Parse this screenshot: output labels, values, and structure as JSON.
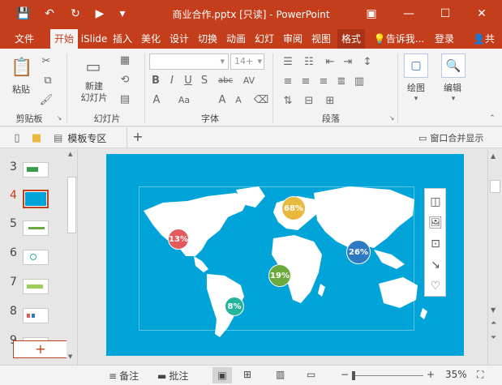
{
  "window": {
    "title": "商业合作.pptx [只读] - PowerPoint",
    "minimize": "—",
    "maximize": "☐",
    "close": "✕",
    "ribbon_display": "▣"
  },
  "quick_access": {
    "save": "💾",
    "undo": "↶",
    "redo": "↻",
    "present": "▶",
    "customize": "▾"
  },
  "tabs": [
    {
      "label": "文件"
    },
    {
      "label": "开始"
    },
    {
      "label": "iSlide"
    },
    {
      "label": "插入"
    },
    {
      "label": "美化"
    },
    {
      "label": "设计"
    },
    {
      "label": "切换"
    },
    {
      "label": "动画"
    },
    {
      "label": "幻灯"
    },
    {
      "label": "审阅"
    },
    {
      "label": "视图"
    },
    {
      "label": "格式"
    },
    {
      "label": "告诉我..."
    },
    {
      "label": "登录"
    },
    {
      "label": "共"
    }
  ],
  "ribbon": {
    "clipboard": {
      "paste": "粘贴",
      "group": "剪贴板"
    },
    "slides": {
      "new_slide": "新建\n幻灯片",
      "group": "幻灯片"
    },
    "font": {
      "size": "14+",
      "group": "字体"
    },
    "paragraph": {
      "group": "段落"
    },
    "drawing": {
      "label": "绘图"
    },
    "editing": {
      "label": "编辑"
    }
  },
  "subbar": {
    "template_area": "模板专区",
    "add": "+",
    "window_merge": "窗口合并显示"
  },
  "thumbnails": {
    "items": [
      {
        "number": "3"
      },
      {
        "number": "4"
      },
      {
        "number": "5"
      },
      {
        "number": "6"
      },
      {
        "number": "7"
      },
      {
        "number": "8"
      },
      {
        "number": "9"
      }
    ],
    "add_button": "+"
  },
  "slide": {
    "bubbles": [
      {
        "label": "68%",
        "color": "#e8b83f"
      },
      {
        "label": "13%",
        "color": "#e4595b"
      },
      {
        "label": "26%",
        "color": "#2e79c4"
      },
      {
        "label": "19%",
        "color": "#6aaa3c"
      },
      {
        "label": "8%",
        "color": "#23b49a"
      }
    ]
  },
  "status": {
    "notes": "备注",
    "comments": "批注",
    "zoom": "35%",
    "zoom_minus": "−",
    "zoom_plus": "+"
  },
  "colors": {
    "accent": "#c43e1c",
    "slide_bg": "#00a4d8"
  }
}
